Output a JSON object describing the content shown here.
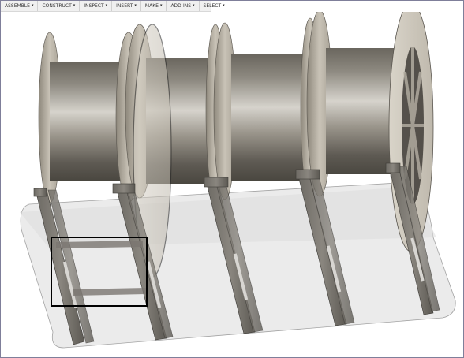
{
  "toolbar": {
    "menus": [
      {
        "label": "ASSEMBLE",
        "caret": "▾"
      },
      {
        "label": "CONSTRUCT",
        "caret": "▾"
      },
      {
        "label": "INSPECT",
        "caret": "▾"
      },
      {
        "label": "INSERT",
        "caret": "▾"
      },
      {
        "label": "MAKE",
        "caret": "▾"
      },
      {
        "label": "ADD-INS",
        "caret": "▾"
      },
      {
        "label": "SELECT",
        "caret": "▾"
      }
    ]
  },
  "colors": {
    "background": "#ffffff",
    "toolbar_bg": "#f0f0f0",
    "spool_dark": "#5a564f",
    "spool_light": "#d8d5cf",
    "flange": "#b8b2a6",
    "base_plate": "#e4e4e4",
    "selection_box": "#000000"
  }
}
